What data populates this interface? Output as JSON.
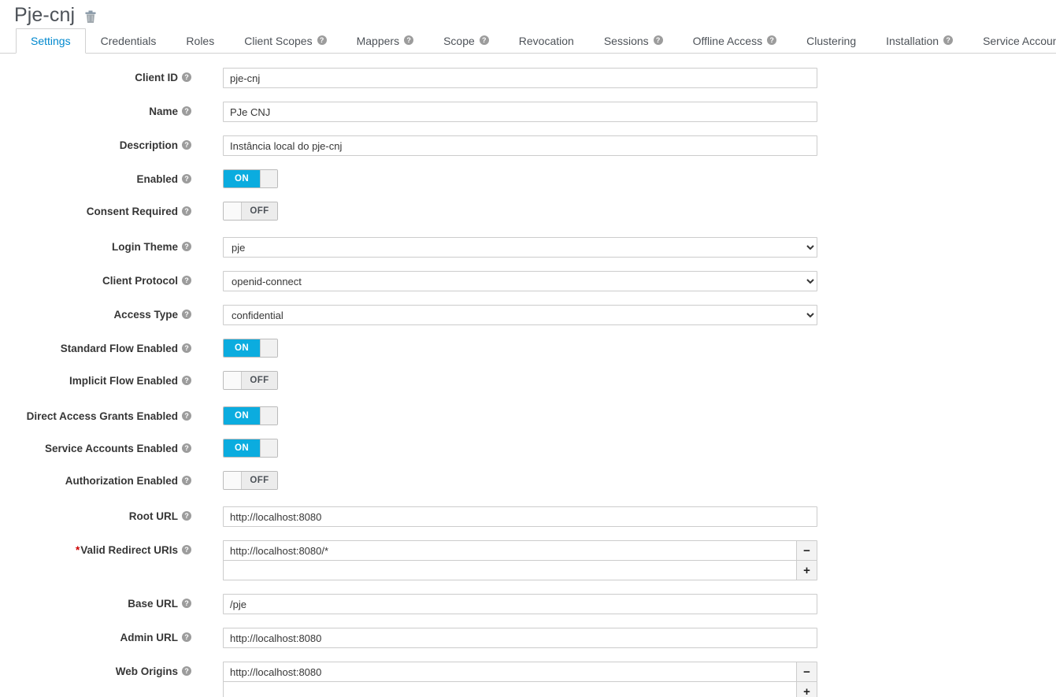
{
  "header": {
    "title": "Pje-cnj",
    "delete_icon": "trash-icon"
  },
  "tabs": [
    {
      "label": "Settings",
      "active": true,
      "help": false
    },
    {
      "label": "Credentials",
      "active": false,
      "help": false
    },
    {
      "label": "Roles",
      "active": false,
      "help": false
    },
    {
      "label": "Client Scopes",
      "active": false,
      "help": true
    },
    {
      "label": "Mappers",
      "active": false,
      "help": true
    },
    {
      "label": "Scope",
      "active": false,
      "help": true
    },
    {
      "label": "Revocation",
      "active": false,
      "help": false
    },
    {
      "label": "Sessions",
      "active": false,
      "help": true
    },
    {
      "label": "Offline Access",
      "active": false,
      "help": true
    },
    {
      "label": "Clustering",
      "active": false,
      "help": false
    },
    {
      "label": "Installation",
      "active": false,
      "help": true
    },
    {
      "label": "Service Account Roles",
      "active": false,
      "help": true
    }
  ],
  "help_glyph": "?",
  "required_marker": "*",
  "fields": {
    "client_id": {
      "label": "Client ID",
      "value": "pje-cnj",
      "placeholder": ""
    },
    "name": {
      "label": "Name",
      "value": "PJe CNJ",
      "placeholder": ""
    },
    "description": {
      "label": "Description",
      "value": "Instância local do pje-cnj",
      "placeholder": ""
    },
    "enabled": {
      "label": "Enabled",
      "state": "ON"
    },
    "consent_required": {
      "label": "Consent Required",
      "state": "OFF"
    },
    "login_theme": {
      "label": "Login Theme",
      "value": "pje",
      "options": [
        "pje"
      ]
    },
    "client_protocol": {
      "label": "Client Protocol",
      "value": "openid-connect",
      "options": [
        "openid-connect"
      ]
    },
    "access_type": {
      "label": "Access Type",
      "value": "confidential",
      "options": [
        "confidential"
      ]
    },
    "standard_flow_enabled": {
      "label": "Standard Flow Enabled",
      "state": "ON"
    },
    "implicit_flow_enabled": {
      "label": "Implicit Flow Enabled",
      "state": "OFF"
    },
    "direct_access_grants_enabled": {
      "label": "Direct Access Grants Enabled",
      "state": "ON"
    },
    "service_accounts_enabled": {
      "label": "Service Accounts Enabled",
      "state": "ON"
    },
    "authorization_enabled": {
      "label": "Authorization Enabled",
      "state": "OFF"
    },
    "root_url": {
      "label": "Root URL",
      "value": "http://localhost:8080",
      "placeholder": ""
    },
    "valid_redirect_uris": {
      "label": "Valid Redirect URIs",
      "required": true,
      "values": [
        "http://localhost:8080/*",
        ""
      ],
      "remove_glyph": "−",
      "add_glyph": "+"
    },
    "base_url": {
      "label": "Base URL",
      "value": "/pje",
      "placeholder": ""
    },
    "admin_url": {
      "label": "Admin URL",
      "value": "http://localhost:8080",
      "placeholder": ""
    },
    "web_origins": {
      "label": "Web Origins",
      "required": false,
      "values": [
        "http://localhost:8080",
        ""
      ],
      "remove_glyph": "−",
      "add_glyph": "+"
    }
  },
  "colors": {
    "accent": "#0088ce",
    "toggle_on": "#0bacdf",
    "required": "#cc0000",
    "border": "#cccccc",
    "text": "#363636"
  }
}
